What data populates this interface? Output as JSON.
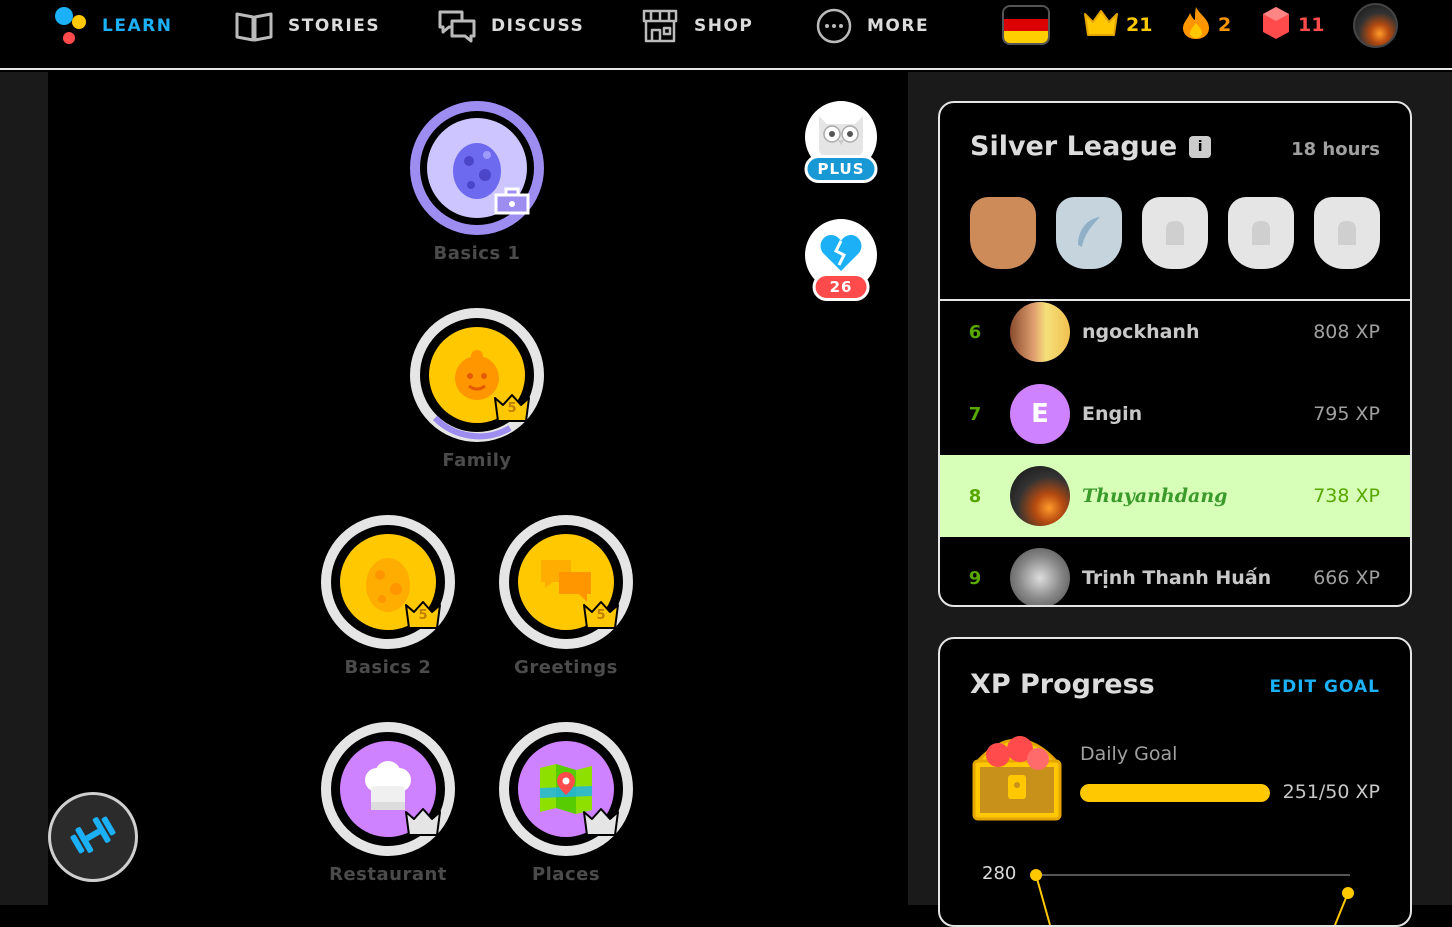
{
  "nav": {
    "learn": "LEARN",
    "stories": "STORIES",
    "discuss": "DISCUSS",
    "shop": "SHOP",
    "more": "MORE"
  },
  "stats": {
    "crowns": "21",
    "streak": "2",
    "gems": "11"
  },
  "skills": [
    {
      "label": "Basics 1",
      "crown": ""
    },
    {
      "label": "Family",
      "crown": "5"
    },
    {
      "label": "Basics 2",
      "crown": "5"
    },
    {
      "label": "Greetings",
      "crown": "5"
    },
    {
      "label": "Restaurant",
      "crown": ""
    },
    {
      "label": "Places",
      "crown": ""
    }
  ],
  "side": {
    "plus_label": "PLUS",
    "hearts_count": "26"
  },
  "league": {
    "title": "Silver League",
    "time_left": "18 hours",
    "rows": [
      {
        "rank": "6",
        "name": "ngockhanh",
        "xp": "808 XP",
        "initial": ""
      },
      {
        "rank": "7",
        "name": "Engin",
        "xp": "795 XP",
        "initial": "E"
      },
      {
        "rank": "8",
        "name": "Thuyanhdang",
        "xp": "738 XP",
        "initial": ""
      },
      {
        "rank": "9",
        "name": "Trịnh Thanh Huấn",
        "xp": "666 XP",
        "initial": ""
      }
    ]
  },
  "xp_progress": {
    "title": "XP Progress",
    "edit_goal": "EDIT GOAL",
    "daily_goal_label": "Daily Goal",
    "progress_text": "251/50 XP",
    "progress_fraction": 1.0,
    "chart_y_label": "280"
  },
  "colors": {
    "accent_blue": "#1cb0f6",
    "gold": "#ffc800",
    "green": "#58a700",
    "purple": "#ce82ff"
  }
}
